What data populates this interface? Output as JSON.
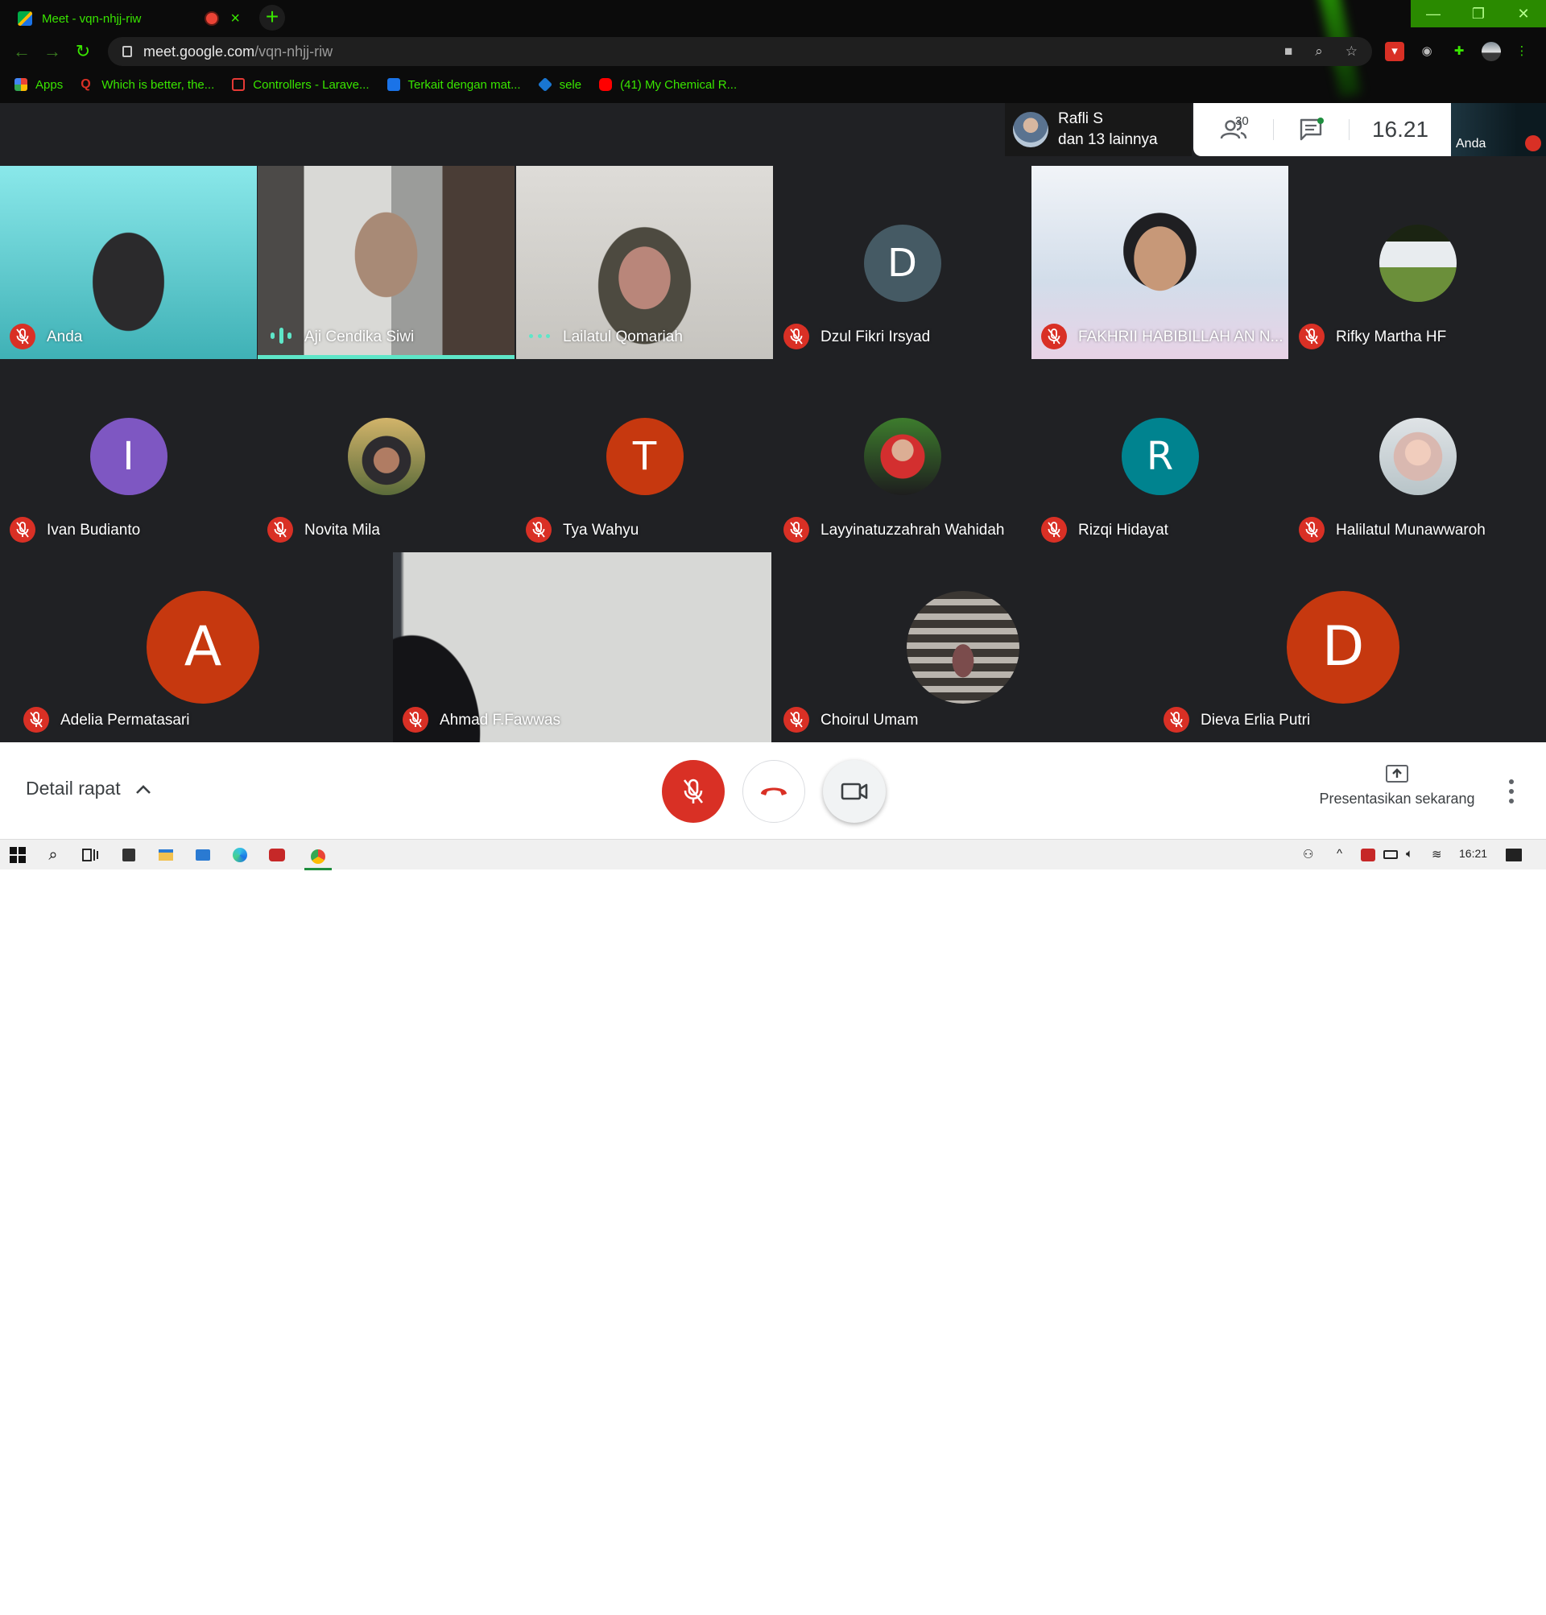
{
  "browser": {
    "tab_title": "Meet - vqn-nhjj-riw",
    "url_host": "meet.google.com",
    "url_path": "/vqn-nhjj-riw",
    "bookmarks": [
      {
        "label": "Apps"
      },
      {
        "label": "Which is better, the..."
      },
      {
        "label": "Controllers - Larave..."
      },
      {
        "label": "Terkait dengan mat..."
      },
      {
        "label": "sele"
      },
      {
        "label": "(41) My Chemical R..."
      }
    ]
  },
  "meet_header": {
    "presenter_name": "Rafli S",
    "presenter_others": "dan 13 lainnya",
    "participant_count": "30",
    "time": "16.21",
    "self_label": "Anda"
  },
  "participants": [
    {
      "name": "Anda",
      "type": "video",
      "mic": "muted"
    },
    {
      "name": "Aji Cendika Siwi",
      "type": "video",
      "mic": "speaking"
    },
    {
      "name": "Lailatul Qomariah",
      "type": "video",
      "mic": "dots"
    },
    {
      "name": "Dzul Fikri Irsyad",
      "type": "initial",
      "initial": "D",
      "color": "#455a64",
      "mic": "muted"
    },
    {
      "name": "FAKHRII HABIBILLAH AN N...",
      "type": "video",
      "mic": "muted"
    },
    {
      "name": "Rifky Martha HF",
      "type": "photo",
      "mic": "muted"
    },
    {
      "name": "Ivan Budianto",
      "type": "initial",
      "initial": "I",
      "color": "#7e57c2",
      "mic": "muted"
    },
    {
      "name": "Novita Mila",
      "type": "photo",
      "mic": "muted"
    },
    {
      "name": "Tya Wahyu",
      "type": "initial",
      "initial": "T",
      "color": "#c6380f",
      "mic": "muted"
    },
    {
      "name": "Layyinatuzzahrah Wahidah",
      "type": "photo",
      "mic": "muted"
    },
    {
      "name": "Rizqi Hidayat",
      "type": "initial",
      "initial": "R",
      "color": "#00838f",
      "mic": "muted"
    },
    {
      "name": "Halilatul Munawwaroh",
      "type": "photo",
      "mic": "muted"
    },
    {
      "name": "Adelia Permatasari",
      "type": "initial",
      "initial": "A",
      "color": "#c6380f",
      "mic": "muted"
    },
    {
      "name": "Ahmad F.Fawwas",
      "type": "video",
      "mic": "muted"
    },
    {
      "name": "Choirul Umam",
      "type": "photo",
      "mic": "muted"
    },
    {
      "name": "Dieva Erlia Putri",
      "type": "initial",
      "initial": "D",
      "color": "#c6380f",
      "mic": "muted"
    }
  ],
  "controls": {
    "details_label": "Detail rapat",
    "present_label": "Presentasikan sekarang"
  },
  "taskbar": {
    "time": "16:21"
  },
  "colors": {
    "meet_bg": "#202124",
    "mute_red": "#d93025",
    "speaking_teal": "#5ee6c8",
    "chrome_accent": "#39e600"
  }
}
